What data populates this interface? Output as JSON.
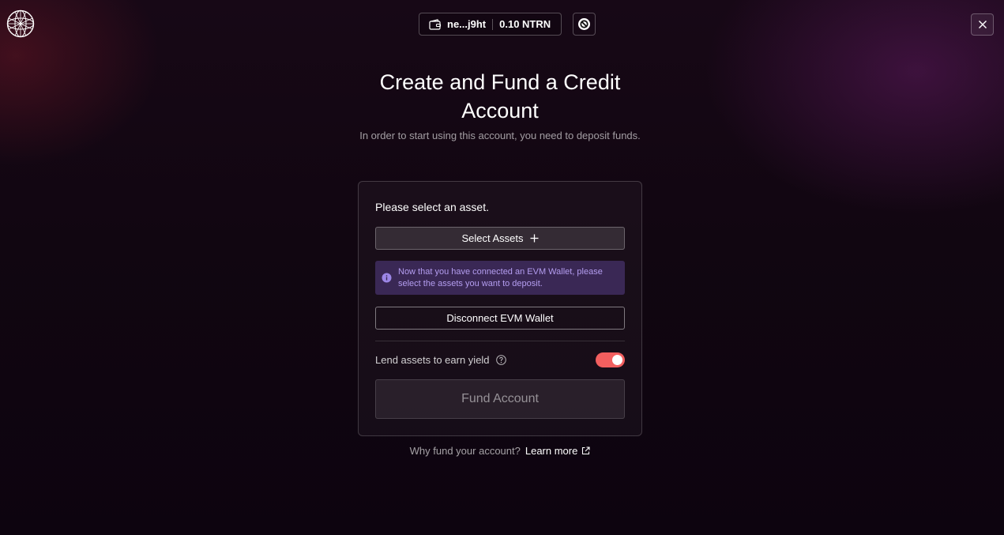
{
  "header": {
    "logo_icon": "globe-network-logo",
    "wallet": {
      "address": "ne...j9ht",
      "balance": "0.10 NTRN",
      "icon": "wallet-icon"
    },
    "network_icon": "neutron-icon",
    "close_icon": "close-icon"
  },
  "main": {
    "title": "Create and Fund a Credit Account",
    "subtitle": "In order to start using this account, you need to deposit funds."
  },
  "card": {
    "heading": "Please select an asset.",
    "select_assets_label": "Select Assets",
    "info_text": "Now that you have connected an EVM Wallet, please select the assets you want to deposit.",
    "disconnect_label": "Disconnect EVM Wallet",
    "lend_label": "Lend assets to earn yield",
    "lend_enabled": true,
    "fund_label": "Fund Account"
  },
  "footer": {
    "question": "Why fund your account?",
    "link_label": "Learn more"
  },
  "colors": {
    "toggle_on": "#f25f5f",
    "info_bg": "#3a2855",
    "info_text": "#b49df0",
    "background": "#110611"
  }
}
